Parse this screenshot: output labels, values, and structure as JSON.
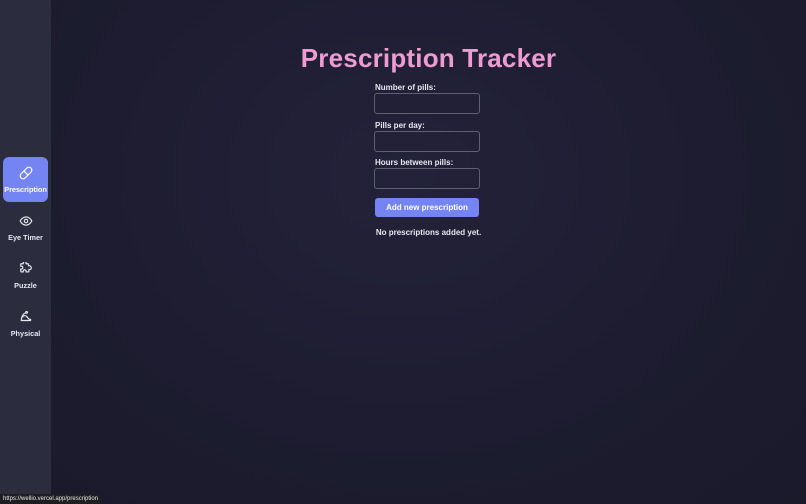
{
  "sidebar": {
    "items": [
      {
        "label": "Prescription",
        "icon": "pill-icon",
        "active": true
      },
      {
        "label": "Eye Timer",
        "icon": "eye-icon",
        "active": false
      },
      {
        "label": "Puzzle",
        "icon": "puzzle-icon",
        "active": false
      },
      {
        "label": "Physical",
        "icon": "activity-icon",
        "active": false
      }
    ]
  },
  "main": {
    "title": "Prescription Tracker",
    "fields": [
      {
        "label": "Number of pills:",
        "value": ""
      },
      {
        "label": "Pills per day:",
        "value": ""
      },
      {
        "label": "Hours between pills:",
        "value": ""
      }
    ],
    "add_button": "Add new prescription",
    "empty_message": "No prescriptions added yet."
  },
  "status_bar": {
    "url": "https://wellio.vercel.app/prescription"
  },
  "colors": {
    "accent": "#7484f3",
    "title": "#ee9ad3",
    "sidebar_bg": "#2b2c3d",
    "page_bg": "#1d1c30"
  }
}
